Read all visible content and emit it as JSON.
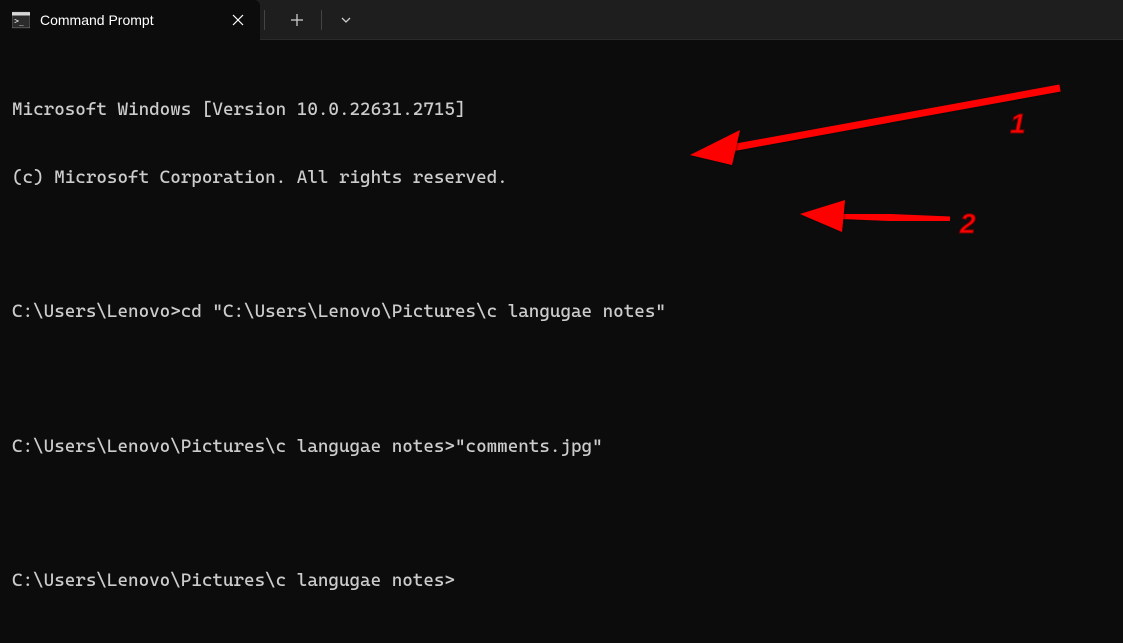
{
  "titlebar": {
    "tab_title": "Command Prompt",
    "close_symbol": "✕",
    "new_tab_symbol": "+",
    "dropdown_symbol": "⌄"
  },
  "terminal": {
    "lines": [
      "Microsoft Windows [Version 10.0.22631.2715]",
      "(c) Microsoft Corporation. All rights reserved.",
      "",
      "C:\\Users\\Lenovo>cd \"C:\\Users\\Lenovo\\Pictures\\c langugae notes\"",
      "",
      "C:\\Users\\Lenovo\\Pictures\\c langugae notes>\"comments.jpg\"",
      "",
      "C:\\Users\\Lenovo\\Pictures\\c langugae notes>"
    ]
  },
  "annotations": {
    "arrow1_label": "1",
    "arrow2_label": "2"
  }
}
